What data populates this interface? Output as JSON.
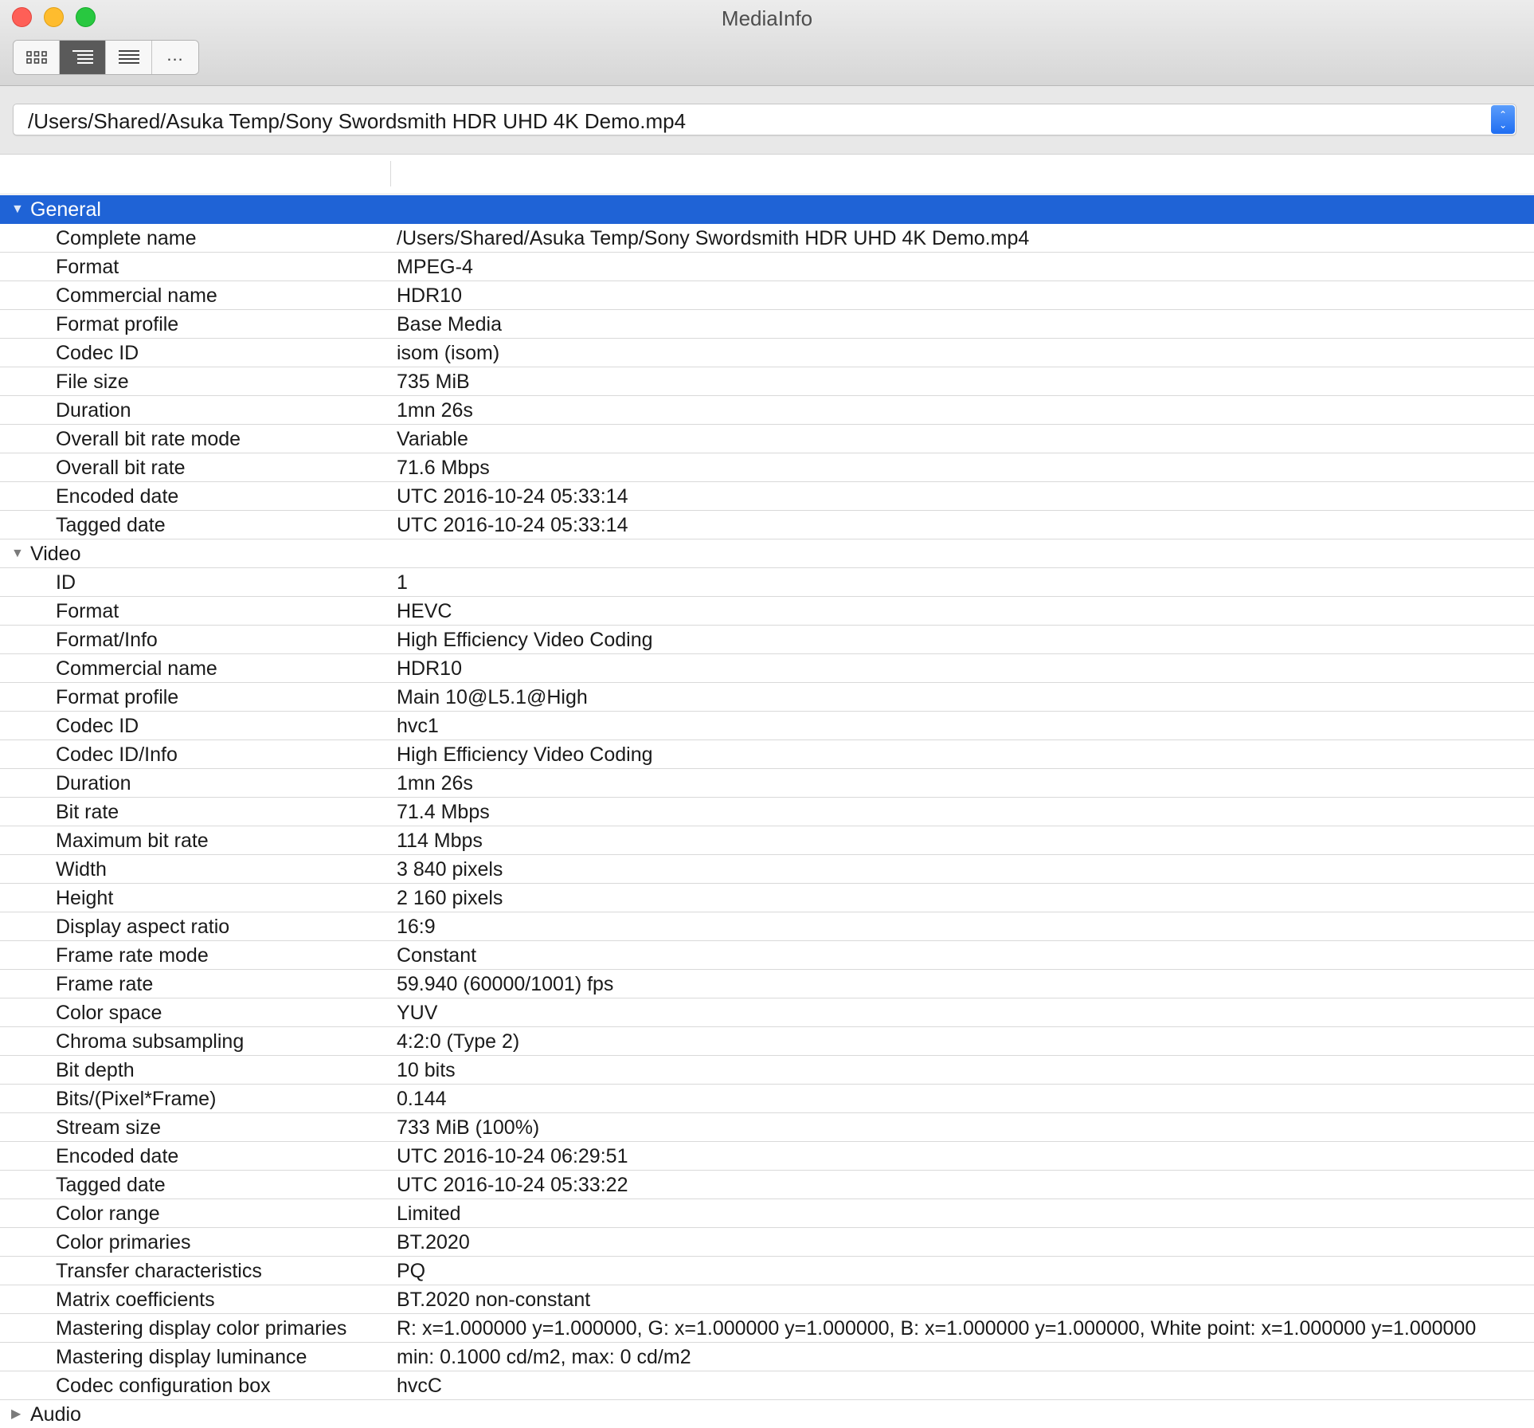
{
  "window": {
    "title": "MediaInfo"
  },
  "toolbar": {
    "views": [
      {
        "name": "grid-view",
        "icon": "grid-icon",
        "active": false
      },
      {
        "name": "tree-view",
        "icon": "tree-list-icon",
        "active": true
      },
      {
        "name": "text-view",
        "icon": "text-list-icon",
        "active": false
      },
      {
        "name": "more",
        "label": "...",
        "active": false
      }
    ],
    "more_label": "..."
  },
  "file_selector": {
    "path": "/Users/Shared/Asuka Temp/Sony Swordsmith HDR UHD 4K Demo.mp4",
    "stepper_icon": "up-down-chevron-icon"
  },
  "colors": {
    "selection": "#1f63d6",
    "stepper": "#1f6ef2"
  },
  "sections": {
    "general": {
      "label": "General",
      "expanded": true,
      "selected": true,
      "rows": [
        {
          "key": "Complete name",
          "value": "/Users/Shared/Asuka Temp/Sony Swordsmith HDR UHD 4K Demo.mp4"
        },
        {
          "key": "Format",
          "value": "MPEG-4"
        },
        {
          "key": "Commercial name",
          "value": "HDR10"
        },
        {
          "key": "Format profile",
          "value": "Base Media"
        },
        {
          "key": "Codec ID",
          "value": "isom (isom)"
        },
        {
          "key": "File size",
          "value": "735 MiB"
        },
        {
          "key": "Duration",
          "value": "1mn 26s"
        },
        {
          "key": "Overall bit rate mode",
          "value": "Variable"
        },
        {
          "key": "Overall bit rate",
          "value": "71.6 Mbps"
        },
        {
          "key": "Encoded date",
          "value": "UTC 2016-10-24 05:33:14"
        },
        {
          "key": "Tagged date",
          "value": "UTC 2016-10-24 05:33:14"
        }
      ]
    },
    "video": {
      "label": "Video",
      "expanded": true,
      "selected": false,
      "rows": [
        {
          "key": "ID",
          "value": "1"
        },
        {
          "key": "Format",
          "value": "HEVC"
        },
        {
          "key": "Format/Info",
          "value": "High Efficiency Video Coding"
        },
        {
          "key": "Commercial name",
          "value": "HDR10"
        },
        {
          "key": "Format profile",
          "value": "Main 10@L5.1@High"
        },
        {
          "key": "Codec ID",
          "value": "hvc1"
        },
        {
          "key": "Codec ID/Info",
          "value": "High Efficiency Video Coding"
        },
        {
          "key": "Duration",
          "value": "1mn 26s"
        },
        {
          "key": "Bit rate",
          "value": "71.4 Mbps"
        },
        {
          "key": "Maximum bit rate",
          "value": "114 Mbps"
        },
        {
          "key": "Width",
          "value": "3 840 pixels"
        },
        {
          "key": "Height",
          "value": "2 160 pixels"
        },
        {
          "key": "Display aspect ratio",
          "value": "16:9"
        },
        {
          "key": "Frame rate mode",
          "value": "Constant"
        },
        {
          "key": "Frame rate",
          "value": "59.940 (60000/1001) fps"
        },
        {
          "key": "Color space",
          "value": "YUV"
        },
        {
          "key": "Chroma subsampling",
          "value": "4:2:0 (Type 2)"
        },
        {
          "key": "Bit depth",
          "value": "10 bits"
        },
        {
          "key": "Bits/(Pixel*Frame)",
          "value": "0.144"
        },
        {
          "key": "Stream size",
          "value": "733 MiB (100%)"
        },
        {
          "key": "Encoded date",
          "value": "UTC 2016-10-24 06:29:51"
        },
        {
          "key": "Tagged date",
          "value": "UTC 2016-10-24 05:33:22"
        },
        {
          "key": "Color range",
          "value": "Limited"
        },
        {
          "key": "Color primaries",
          "value": "BT.2020"
        },
        {
          "key": "Transfer characteristics",
          "value": "PQ"
        },
        {
          "key": "Matrix coefficients",
          "value": "BT.2020 non-constant"
        },
        {
          "key": "Mastering display color primaries",
          "value": "R: x=1.000000 y=1.000000, G: x=1.000000 y=1.000000, B: x=1.000000 y=1.000000, White point: x=1.000000 y=1.000000"
        },
        {
          "key": "Mastering display luminance",
          "value": "min: 0.1000 cd/m2, max: 0 cd/m2"
        },
        {
          "key": "Codec configuration box",
          "value": "hvcC"
        }
      ]
    },
    "audio": {
      "label": "Audio",
      "expanded": false,
      "selected": false,
      "rows": []
    }
  }
}
